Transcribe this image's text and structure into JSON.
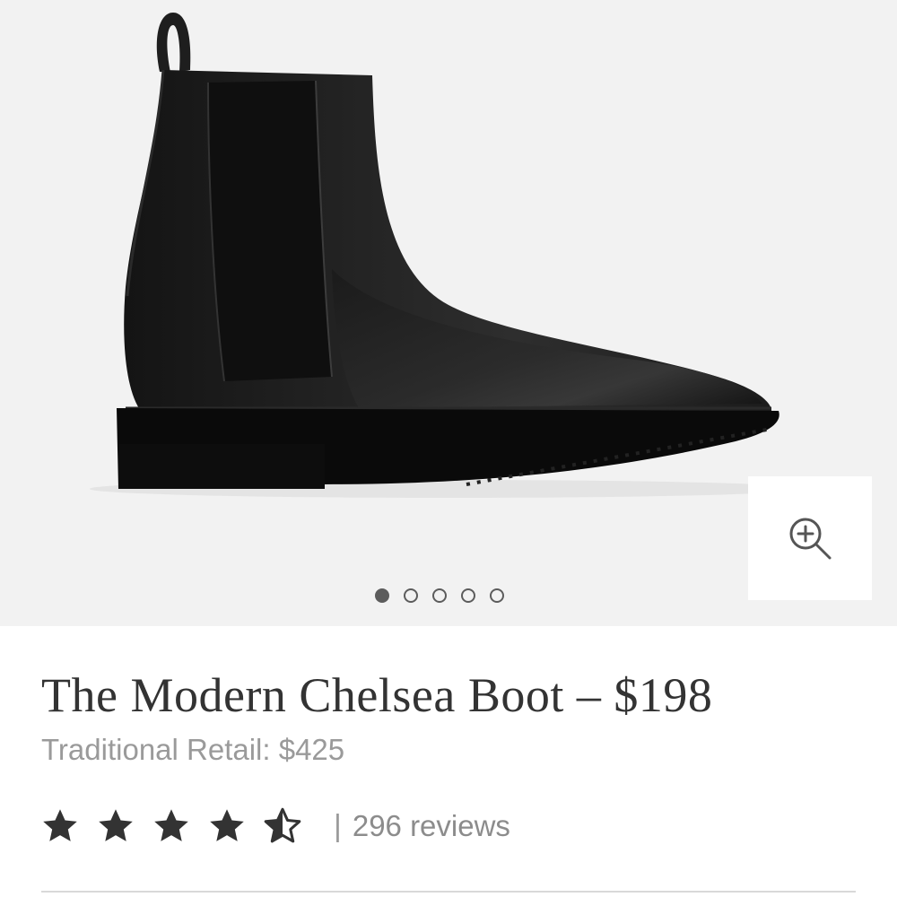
{
  "product": {
    "title": "The Modern Chelsea Boot – $198",
    "traditional_retail": "Traditional Retail: $425",
    "rating": {
      "value": 4.5,
      "max": 5,
      "separator": "|",
      "reviews_label": "296 reviews"
    }
  },
  "gallery": {
    "image_count": 5,
    "active_index": 1,
    "zoom_icon": "zoom-in-icon"
  },
  "colors": {
    "gallery_background": "#f2f2f2",
    "star_fill": "#333333",
    "muted_text": "#9a9a9a",
    "title_text": "#333333"
  }
}
